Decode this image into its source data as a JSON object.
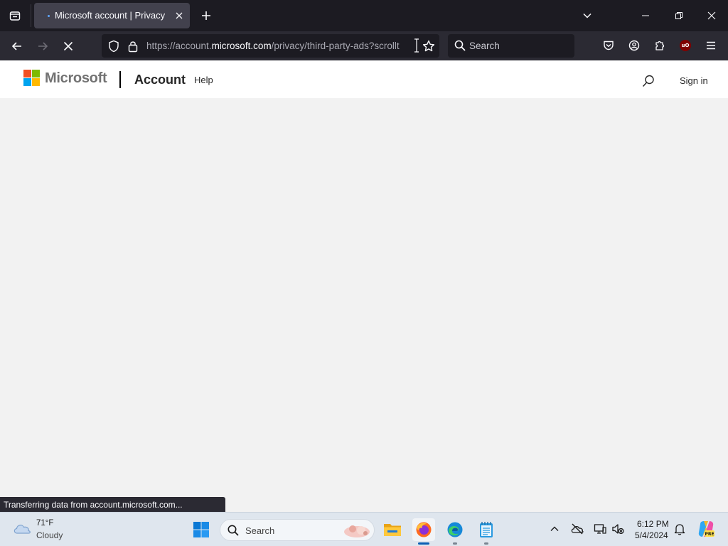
{
  "browser": {
    "tab": {
      "title": "Microsoft account | Privacy"
    },
    "url": {
      "prefix": "https://account.",
      "host": "microsoft.com",
      "path": "/privacy/third-party-ads?scrollt"
    },
    "search_placeholder": "Search",
    "status": "Transferring data from account.microsoft.com...",
    "icons": {
      "tab_list": "tab-list-icon",
      "new_tab": "plus-icon",
      "list_all": "chevron-down-icon",
      "back": "arrow-left-icon",
      "forward": "arrow-right-icon",
      "stop": "stop-loading-icon",
      "tracking": "shield-icon",
      "lock": "lock-icon",
      "bookmark": "star-icon",
      "pocket": "pocket-icon",
      "account": "account-icon",
      "extensions": "puzzle-icon",
      "ublock": "ublock-origin-icon",
      "menu": "hamburger-menu-icon"
    }
  },
  "site": {
    "brand": "Microsoft",
    "section": "Account",
    "help": "Help",
    "sign_in": "Sign in",
    "logo_colors": [
      "#f25022",
      "#7fba00",
      "#00a4ef",
      "#ffb900"
    ]
  },
  "taskbar": {
    "weather": {
      "temp": "71°F",
      "condition": "Cloudy"
    },
    "search_placeholder": "Search",
    "clock": {
      "time": "6:12 PM",
      "date": "5/4/2024"
    },
    "apps": [
      "start-icon",
      "file-explorer-icon",
      "firefox-icon",
      "edge-icon",
      "notepad-icon"
    ],
    "tray": [
      "chevron-up-icon",
      "onedrive-off-icon",
      "display-icon",
      "sound-muted-icon",
      "bell-icon",
      "copilot-icon"
    ],
    "tray_badge": "PRE"
  }
}
